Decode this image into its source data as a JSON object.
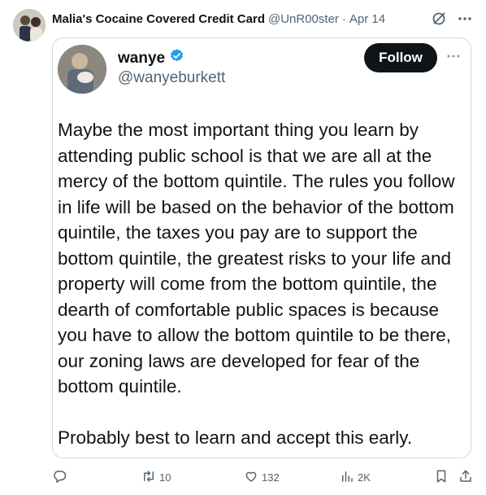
{
  "tweet": {
    "display_name": "Malia's Cocaine Covered Credit Card",
    "handle": "@UnR00ster",
    "separator": "·",
    "date": "Apr 14"
  },
  "quoted": {
    "display_name": "wanye",
    "handle": "@wanyeburkett",
    "follow_label": "Follow",
    "paragraphs": [
      "Maybe the most important thing you learn by attending public school is that we are all at the mercy of the bottom quintile. The rules you follow in life will be based on the behavior of the bottom quintile, the taxes you pay are to support the bottom quintile, the greatest risks to your life and property will come from the bottom quintile, the dearth of comfortable public spaces is because you have to allow the bottom quintile to be there, our zoning laws are developed for fear of the bottom quintile.",
      "Probably best to learn and accept this early."
    ]
  },
  "actions": {
    "retweets": "10",
    "likes": "132",
    "views": "2K"
  },
  "icons": {
    "grok": "grok-icon",
    "more": "more-icon",
    "verified": "verified-badge-icon",
    "reply": "reply-icon",
    "retweet": "retweet-icon",
    "like": "heart-icon",
    "views": "analytics-icon",
    "bookmark": "bookmark-icon",
    "share": "share-icon"
  },
  "colors": {
    "text": "#0f1419",
    "secondary": "#536471",
    "verified": "#1d9bf0",
    "follow_bg": "#0f1419",
    "border": "#cfd9de"
  }
}
